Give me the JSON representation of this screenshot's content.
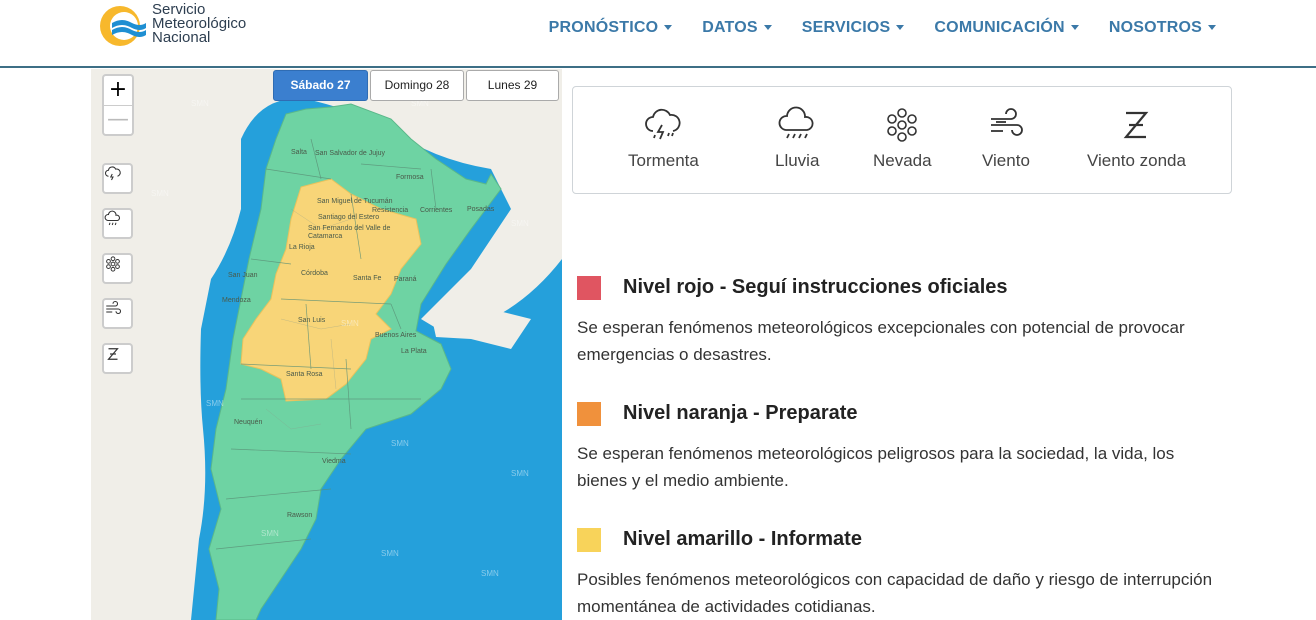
{
  "header": {
    "logo_lines": [
      "Servicio",
      "Meteorológico",
      "Nacional"
    ],
    "nav": [
      {
        "label": "PRONÓSTICO"
      },
      {
        "label": "DATOS"
      },
      {
        "label": "SERVICIOS"
      },
      {
        "label": "COMUNICACIÓN"
      },
      {
        "label": "NOSOTROS"
      }
    ]
  },
  "map": {
    "zoom_in": "+",
    "zoom_out": "—",
    "days": [
      "Sábado 27",
      "Domingo 28",
      "Lunes 29"
    ],
    "selected_day": "Sábado 27",
    "tool_icons": [
      "storm-icon",
      "rain-icon",
      "snow-icon",
      "wind-icon",
      "zonda-icon"
    ],
    "cities": [
      "Salta",
      "San Salvador de Jujuy",
      "Formosa",
      "San Miguel de Tucumán",
      "Resistencia",
      "Corrientes",
      "Posadas",
      "Santiago del Estero",
      "San Fernando del Valle de Catamarca",
      "La Rioja",
      "San Juan",
      "Córdoba",
      "Santa Fe",
      "Paraná",
      "Mendoza",
      "San Luis",
      "Buenos Aires",
      "La Plata",
      "Santa Rosa",
      "Neuquén",
      "Viedma",
      "Rawson"
    ],
    "watermark": "SMN",
    "colors": {
      "sea": "#25a0db",
      "land": "#f0eee8",
      "green": "#6ed3a3",
      "yellow": "#f8d578"
    }
  },
  "phenomena": [
    {
      "label": "Tormenta",
      "icon": "storm-icon"
    },
    {
      "label": "Lluvia",
      "icon": "rain-icon"
    },
    {
      "label": "Nevada",
      "icon": "snow-icon"
    },
    {
      "label": "Viento",
      "icon": "wind-icon"
    },
    {
      "label": "Viento zonda",
      "icon": "zonda-icon"
    }
  ],
  "levels": [
    {
      "title": "Nivel rojo - Seguí instrucciones oficiales",
      "desc": "Se esperan fenómenos meteorológicos excepcionales con potencial de provocar emergencias o desastres.",
      "color": "#e05561"
    },
    {
      "title": "Nivel naranja - Preparate",
      "desc": "Se esperan fenómenos meteorológicos peligrosos para la sociedad, la vida, los bienes y el medio ambiente.",
      "color": "#f0913c"
    },
    {
      "title": "Nivel amarillo - Informate",
      "desc": "Posibles fenómenos meteorológicos con capacidad de daño y riesgo de interrupción momentánea de actividades cotidianas.",
      "color": "#f8d35a"
    }
  ]
}
